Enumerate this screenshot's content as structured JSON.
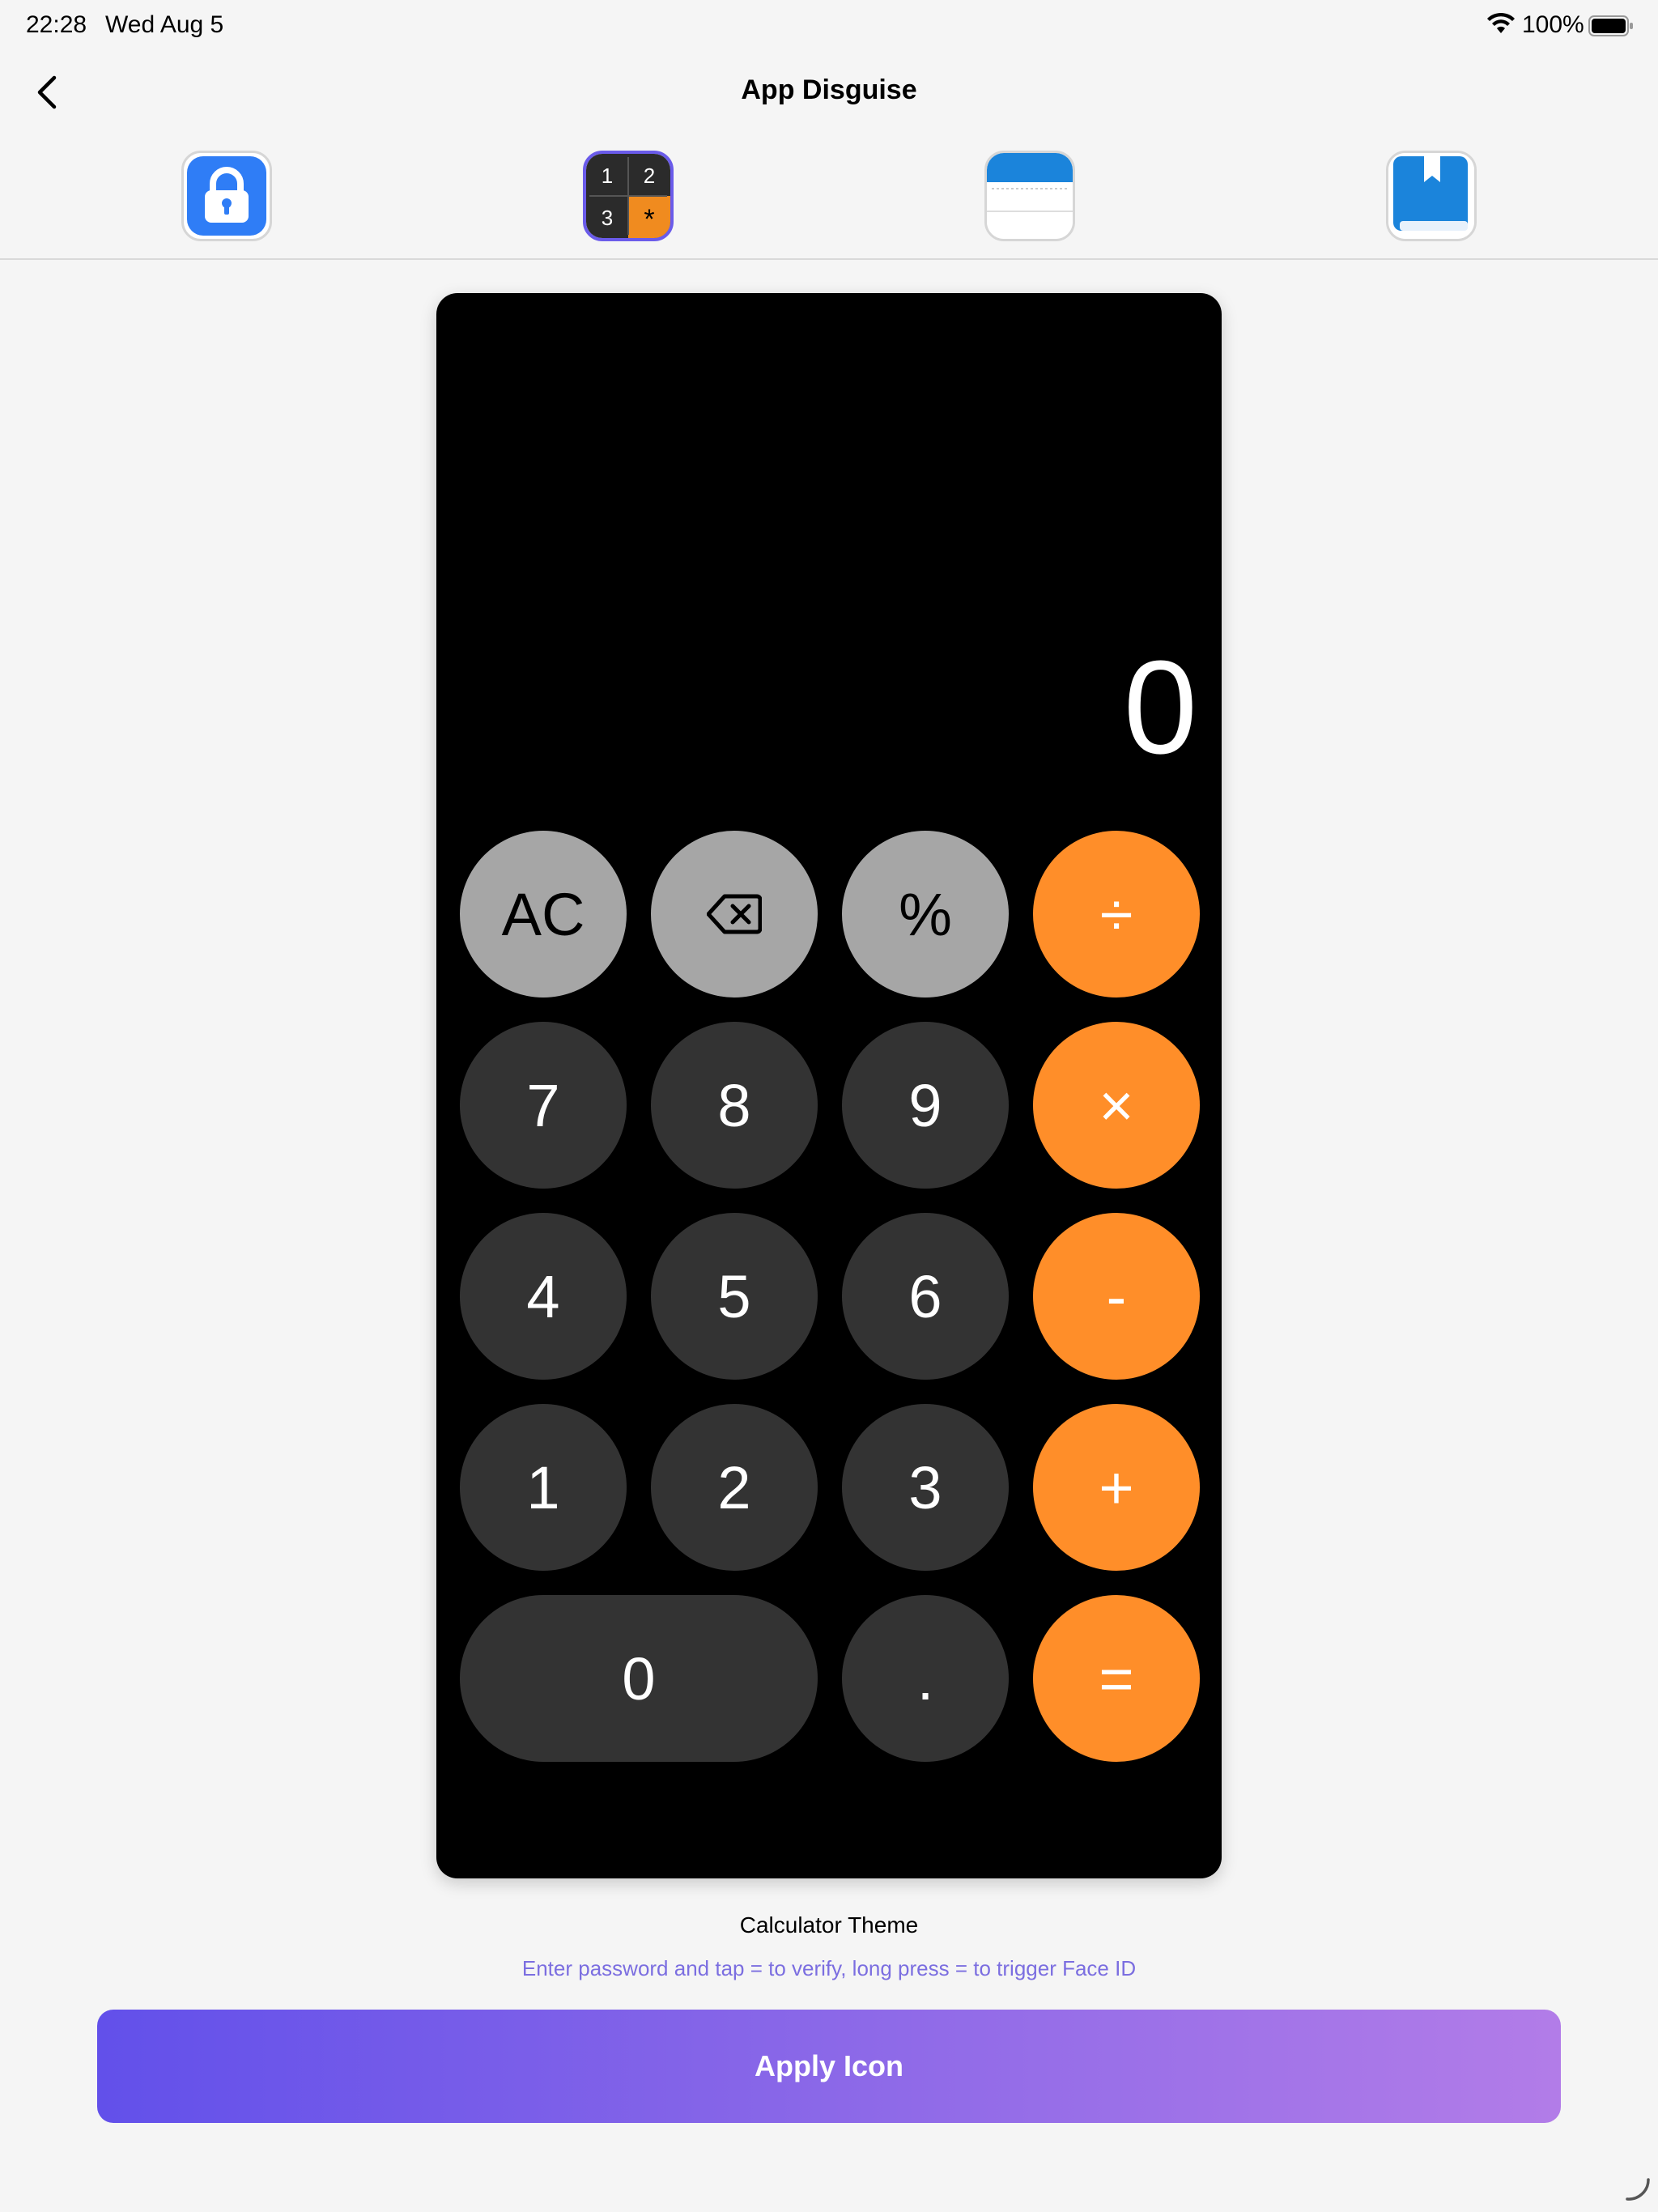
{
  "status_bar": {
    "time": "22:28",
    "date": "Wed Aug 5",
    "battery_text": "100%",
    "wifi_icon": "wifi-icon",
    "battery_icon": "battery-icon"
  },
  "nav": {
    "title": "App Disguise",
    "back_icon": "chevron-left-icon"
  },
  "icon_options": [
    {
      "name": "lock",
      "icon": "lock-app-icon",
      "selected": false
    },
    {
      "name": "calculator",
      "icon": "calculator-app-icon",
      "selected": true,
      "digits": [
        "1",
        "2",
        "3",
        "*"
      ]
    },
    {
      "name": "notes",
      "icon": "notes-app-icon",
      "selected": false
    },
    {
      "name": "book",
      "icon": "book-app-icon",
      "selected": false
    }
  ],
  "calculator": {
    "display": "0",
    "rows": [
      [
        "AC",
        "⌫",
        "%",
        "÷"
      ],
      [
        "7",
        "8",
        "9",
        "×"
      ],
      [
        "4",
        "5",
        "6",
        "-"
      ],
      [
        "1",
        "2",
        "3",
        "+"
      ],
      [
        "0",
        ".",
        "="
      ]
    ],
    "colors": {
      "function": "#a6a6a6",
      "digit": "#333333",
      "operator": "#ff8e29"
    }
  },
  "theme": {
    "label": "Calculator Theme",
    "hint": "Enter password and tap = to verify, long press = to trigger Face ID"
  },
  "apply_button": {
    "label": "Apply Icon"
  },
  "colors": {
    "accent": "#6a5bea",
    "gradient_start": "#6250ea",
    "gradient_end": "#b27ce8",
    "hint": "#7b6ee0"
  }
}
